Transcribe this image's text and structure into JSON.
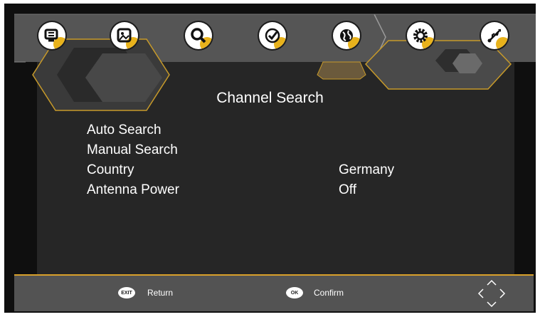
{
  "header": {
    "title": "Channel Search",
    "icons": [
      {
        "name": "picture-icon"
      },
      {
        "name": "image-icon"
      },
      {
        "name": "search-icon"
      },
      {
        "name": "clock-icon"
      },
      {
        "name": "globe-icon"
      },
      {
        "name": "gear-icon"
      },
      {
        "name": "usb-icon"
      }
    ],
    "active_icon": "search-icon",
    "accent_color": "#e8b21c"
  },
  "menu": {
    "items": [
      {
        "label": "Auto Search",
        "value": ""
      },
      {
        "label": "Manual Search",
        "value": ""
      },
      {
        "label": "Country",
        "value": "Germany"
      },
      {
        "label": "Antenna Power",
        "value": "Off"
      }
    ]
  },
  "footer": {
    "exit_key": "EXIT",
    "return_label": "Return",
    "ok_key": "OK",
    "confirm_label": "Confirm"
  }
}
